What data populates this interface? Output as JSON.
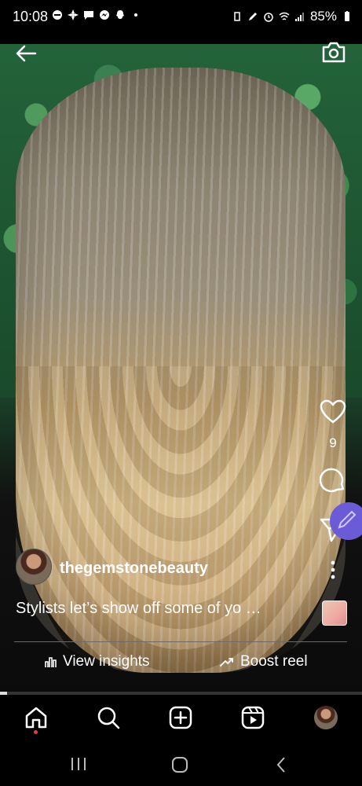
{
  "status": {
    "time": "10:08",
    "battery": "85%"
  },
  "reel": {
    "like_count": "9",
    "author": "thegemstonebeauty",
    "caption": "Stylists let’s show off some of yo …",
    "progress_fraction": 0.02
  },
  "actions": {
    "insights_label": "View insights",
    "boost_label": "Boost reel"
  },
  "icons": {
    "back": "arrow-left-icon",
    "camera": "camera-icon",
    "like": "heart-icon",
    "comment": "comment-icon",
    "share": "send-icon",
    "more": "more-vertical-icon",
    "home": "home-icon",
    "search": "search-icon",
    "create": "plus-square-icon",
    "reels": "reels-icon",
    "profile": "avatar"
  }
}
